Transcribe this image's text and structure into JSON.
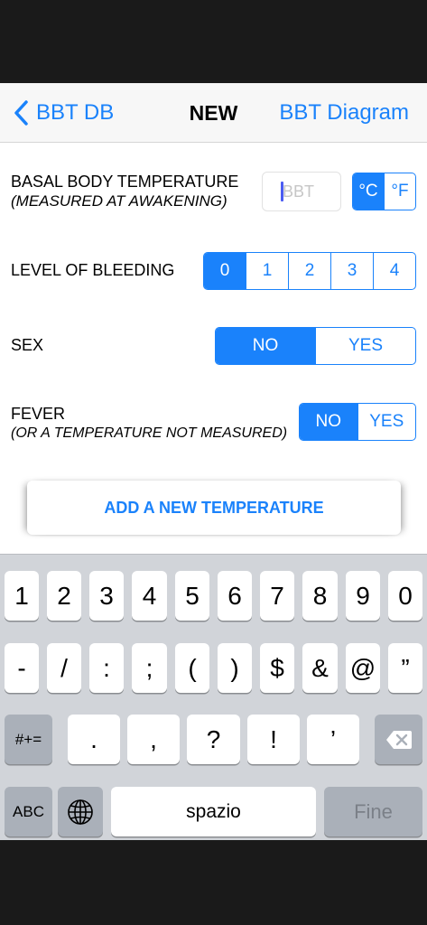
{
  "navbar": {
    "back_label": "BBT DB",
    "title": "NEW",
    "right_label": "BBT Diagram"
  },
  "form": {
    "bbt": {
      "label": "BASAL BODY TEMPERATURE",
      "sublabel": "(MEASURED AT AWAKENING)",
      "placeholder": "BBT",
      "units": [
        "°C",
        "°F"
      ],
      "selected_unit": "°C"
    },
    "bleeding": {
      "label": "LEVEL OF BLEEDING",
      "options": [
        "0",
        "1",
        "2",
        "3",
        "4"
      ],
      "selected": "0"
    },
    "sex": {
      "label": "SEX",
      "options": [
        "NO",
        "YES"
      ],
      "selected": "NO"
    },
    "fever": {
      "label": "FEVER",
      "sublabel": "(OR A TEMPERATURE NOT MEASURED)",
      "options": [
        "NO",
        "YES"
      ],
      "selected": "NO"
    },
    "add_button_label": "ADD A NEW TEMPERATURE"
  },
  "keyboard": {
    "row1": [
      "1",
      "2",
      "3",
      "4",
      "5",
      "6",
      "7",
      "8",
      "9",
      "0"
    ],
    "row2": [
      "-",
      "/",
      ":",
      ";",
      "(",
      ")",
      "$",
      "&",
      "@",
      "”"
    ],
    "row3_mode": "#+=",
    "row3": [
      ".",
      ",",
      "?",
      "!",
      "’"
    ],
    "abc_label": "ABC",
    "space_label": "spazio",
    "return_label": "Fine"
  },
  "colors": {
    "accent": "#1a82fb",
    "navbar_bg": "#f7f7f7",
    "keyboard_bg": "#d1d4d9",
    "key_bg": "#ffffff",
    "special_key_bg": "#aab0b9"
  },
  "icons": {
    "back": "chevron-left-icon",
    "globe": "globe-icon",
    "delete": "backspace-icon"
  }
}
